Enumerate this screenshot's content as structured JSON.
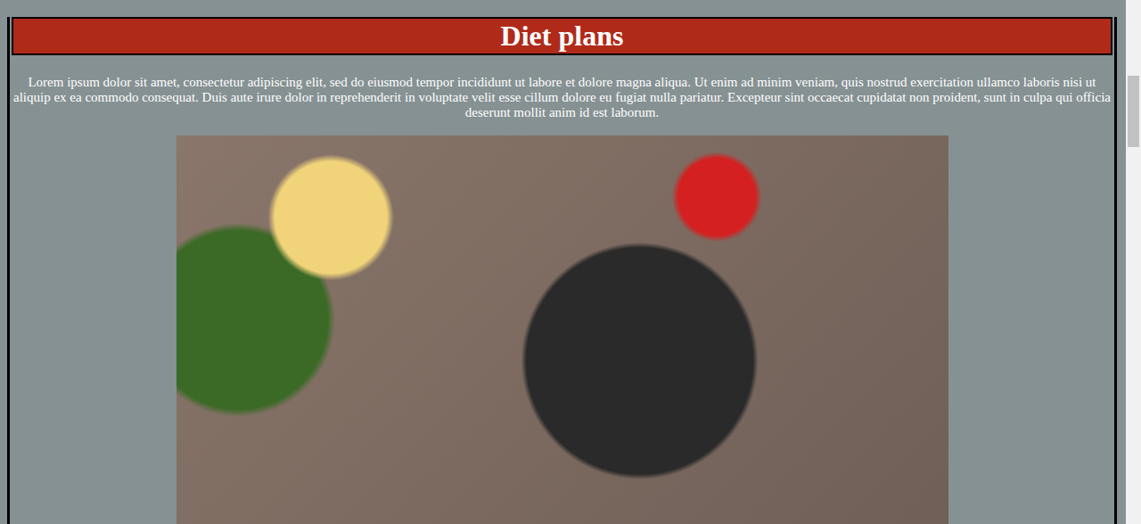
{
  "heading": "Diet plans",
  "paragraph": "Lorem ipsum dolor sit amet, consectetur adipiscing elit, sed do eiusmod tempor incididunt ut labore et dolore magna aliqua. Ut enim ad minim veniam, quis nostrud exercitation ullamco laboris nisi ut aliquip ex ea commodo consequat. Duis aute irure dolor in reprehenderit in voluptate velit esse cillum dolore eu fugiat nulla pariatur. Excepteur sint occaecat cupidatat non proident, sunt in culpa qui officia deserunt mollit anim id est laborum."
}
